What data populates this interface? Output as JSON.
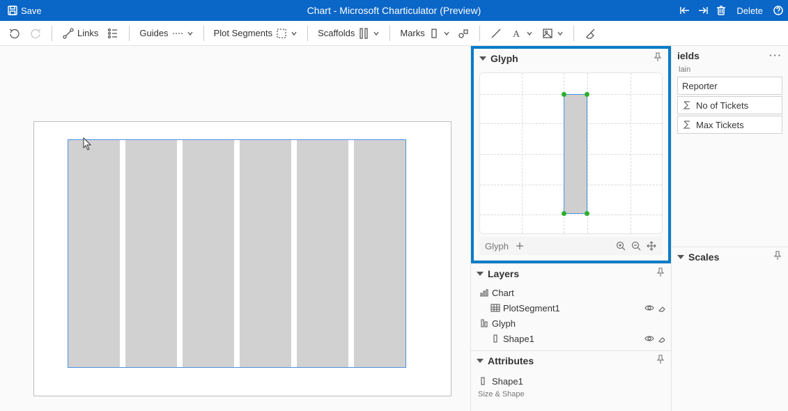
{
  "titlebar": {
    "save_label": "Save",
    "title": "Chart - Microsoft Charticulator (Preview)",
    "delete_label": "Delete"
  },
  "ribbon": {
    "links_label": "Links",
    "guides_label": "Guides",
    "plot_segments_label": "Plot Segments",
    "scaffolds_label": "Scaffolds",
    "marks_label": "Marks"
  },
  "glyph_panel": {
    "title": "Glyph",
    "footer_label": "Glyph"
  },
  "layers": {
    "title": "Layers",
    "chart_label": "Chart",
    "plotsegment_label": "PlotSegment1",
    "glyph_label": "Glyph",
    "shape_label": "Shape1"
  },
  "attributes": {
    "title": "Attributes",
    "item_label": "Shape1",
    "subsection": "Size & Shape"
  },
  "fields": {
    "title": "ields",
    "source_sub": "lain",
    "items": [
      "Reporter",
      "No of Tickets",
      "Max Tickets"
    ]
  },
  "scales": {
    "title": "Scales"
  }
}
